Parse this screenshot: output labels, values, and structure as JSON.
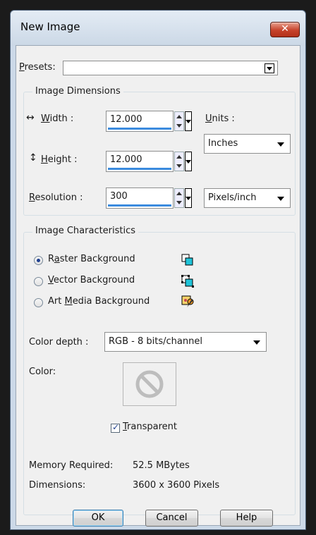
{
  "window": {
    "title": "New Image",
    "close_glyph": "✕"
  },
  "presets": {
    "label_prefix": "",
    "label_accel": "P",
    "label_rest": "resets:",
    "value": ""
  },
  "image_dimensions": {
    "group_title": "Image Dimensions",
    "width": {
      "icon": "↔",
      "accel": "W",
      "rest": "idth :",
      "value": "12.000"
    },
    "height": {
      "icon": "↕",
      "accel": "H",
      "rest": "eight :",
      "value": "12.000"
    },
    "resolution": {
      "accel": "R",
      "rest": "esolution :",
      "value": "300"
    },
    "units_label_accel": "U",
    "units_label_rest": "nits :",
    "units_value": "Inches",
    "resolution_unit": "Pixels/inch"
  },
  "image_characteristics": {
    "group_title": "Image Characteristics",
    "raster": {
      "pre": "R",
      "accel": "a",
      "rest": "ster Background",
      "selected": true,
      "icon": "raster-layer-icon"
    },
    "vector": {
      "pre": "",
      "accel": "V",
      "rest": "ector Background",
      "selected": false,
      "icon": "vector-layer-icon"
    },
    "art_media": {
      "pre": "Art ",
      "accel": "M",
      "rest": "edia Background",
      "selected": false,
      "icon": "art-media-icon"
    },
    "color_depth_label": "Color depth :",
    "color_depth_value": "RGB - 8 bits/channel",
    "color_label": "Color:",
    "transparent": {
      "accel": "T",
      "rest": "ransparent",
      "checked": true
    }
  },
  "memory": {
    "label": "Memory Required:",
    "value": "52.5 MBytes"
  },
  "dimensions": {
    "label": "Dimensions:",
    "value": "3600 x 3600 Pixels"
  },
  "buttons": {
    "ok": "OK",
    "cancel": "Cancel",
    "help": "Help"
  },
  "colors": {
    "accent": "#3b8bde",
    "title_bar": "#ccd9e8",
    "close": "#c6422b"
  }
}
